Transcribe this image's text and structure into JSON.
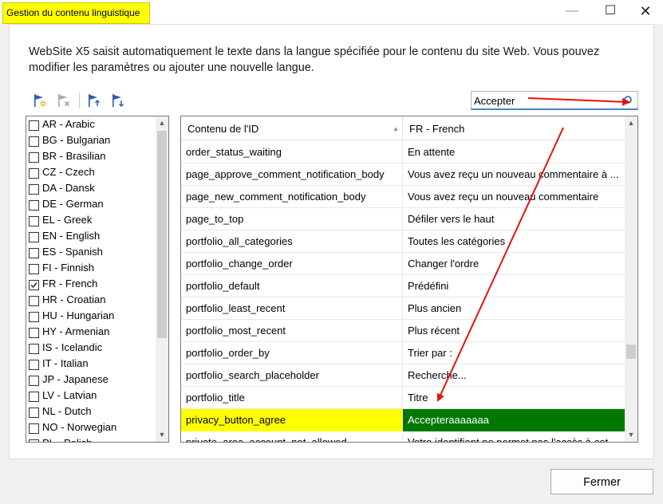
{
  "window": {
    "title": "Gestion du contenu linguistique",
    "controls": {
      "minimize": "—",
      "maximize": "☐",
      "close": "✕"
    }
  },
  "description": "WebSite X5 saisit automatiquement le texte dans la langue spécifiée pour le contenu du site Web. Vous pouvez modifier les paramètres ou ajouter une nouvelle langue.",
  "toolbar": {
    "tools": [
      "add-language-icon",
      "remove-language-icon",
      "move-up-icon",
      "move-down-icon"
    ]
  },
  "search": {
    "value": "Accepter",
    "icon": "search-icon"
  },
  "languages": [
    {
      "label": "AR - Arabic",
      "checked": false
    },
    {
      "label": "BG - Bulgarian",
      "checked": false
    },
    {
      "label": "BR - Brasilian",
      "checked": false
    },
    {
      "label": "CZ - Czech",
      "checked": false
    },
    {
      "label": "DA - Dansk",
      "checked": false
    },
    {
      "label": "DE - German",
      "checked": false
    },
    {
      "label": "EL - Greek",
      "checked": false
    },
    {
      "label": "EN - English",
      "checked": false
    },
    {
      "label": "ES - Spanish",
      "checked": false
    },
    {
      "label": "FI - Finnish",
      "checked": false
    },
    {
      "label": "FR - French",
      "checked": true
    },
    {
      "label": "HR - Croatian",
      "checked": false
    },
    {
      "label": "HU - Hungarian",
      "checked": false
    },
    {
      "label": "HY - Armenian",
      "checked": false
    },
    {
      "label": "IS - Icelandic",
      "checked": false
    },
    {
      "label": "IT - Italian",
      "checked": false
    },
    {
      "label": "JP - Japanese",
      "checked": false
    },
    {
      "label": "LV - Latvian",
      "checked": false
    },
    {
      "label": "NL - Dutch",
      "checked": false
    },
    {
      "label": "NO - Norwegian",
      "checked": false
    },
    {
      "label": "PL - Polish",
      "checked": false
    }
  ],
  "grid": {
    "columns": [
      "Contenu de l'ID",
      "FR - French"
    ],
    "rows": [
      {
        "id": "order_status_waiting",
        "value": "En attente"
      },
      {
        "id": "page_approve_comment_notification_body",
        "value": "Vous avez reçu un nouveau commentaire à ..."
      },
      {
        "id": "page_new_comment_notification_body",
        "value": "Vous avez reçu un nouveau commentaire"
      },
      {
        "id": "page_to_top",
        "value": "Défiler vers le haut"
      },
      {
        "id": "portfolio_all_categories",
        "value": "Toutes les catégories"
      },
      {
        "id": "portfolio_change_order",
        "value": "Changer l'ordre"
      },
      {
        "id": "portfolio_default",
        "value": "Prédéfini"
      },
      {
        "id": "portfolio_least_recent",
        "value": "Plus ancien"
      },
      {
        "id": "portfolio_most_recent",
        "value": "Plus récent"
      },
      {
        "id": "portfolio_order_by",
        "value": "Trier par :"
      },
      {
        "id": "portfolio_search_placeholder",
        "value": "Recherche..."
      },
      {
        "id": "portfolio_title",
        "value": "Titre"
      },
      {
        "id": "privacy_button_agree",
        "value": "Accepteraaaaaaa",
        "selected": true
      },
      {
        "id": "private_area_account_not_allowed",
        "value": "Votre identifiant ne permet pas l'accès à cet..."
      }
    ]
  },
  "buttons": {
    "close": "Fermer"
  },
  "colors": {
    "title_highlight": "#ffff00",
    "selected_id_bg": "#ffff00",
    "selected_value_bg": "#007800",
    "annotation_arrow": "#e81010"
  }
}
